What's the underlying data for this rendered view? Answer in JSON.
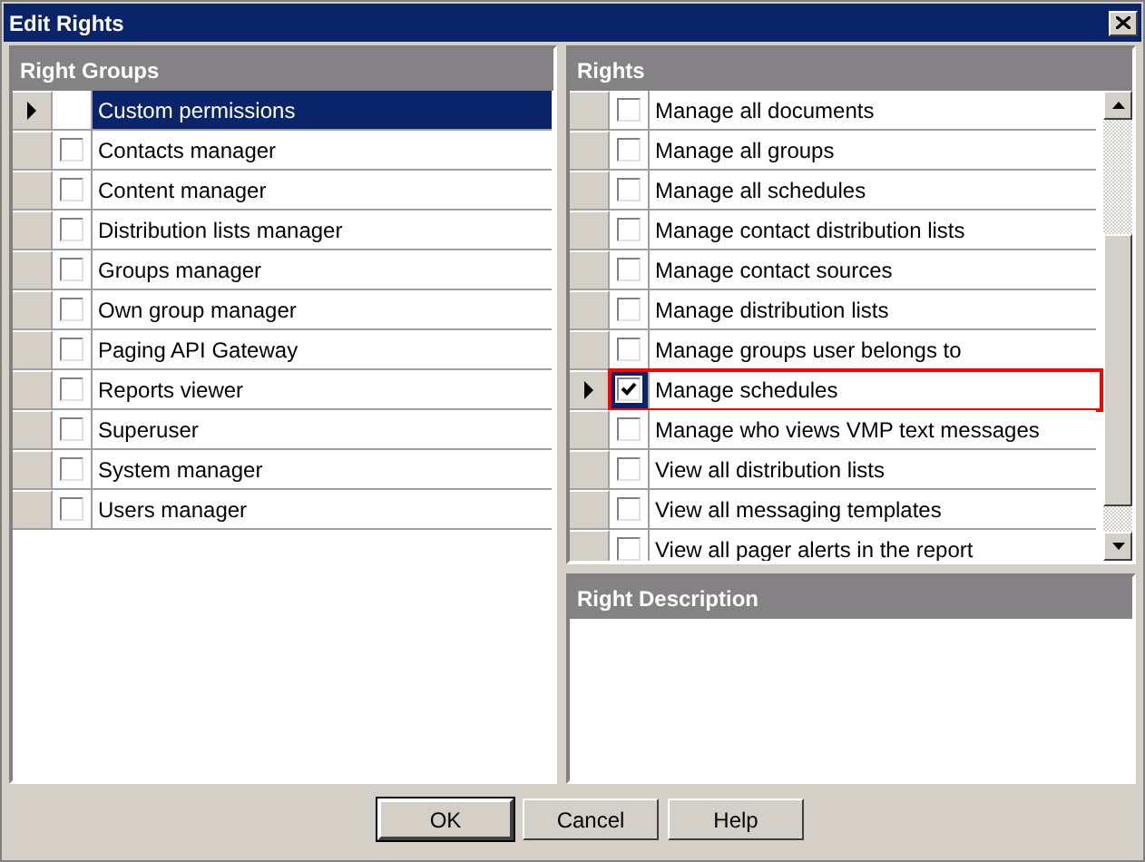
{
  "window": {
    "title": "Edit Rights"
  },
  "right_groups": {
    "title": "Right Groups",
    "items": [
      {
        "label": "Custom permissions",
        "kind": "plain",
        "selected": true
      },
      {
        "label": "Contacts manager",
        "kind": "checkbox",
        "checked": false,
        "selected": false
      },
      {
        "label": "Content manager",
        "kind": "checkbox",
        "checked": false,
        "selected": false
      },
      {
        "label": "Distribution lists manager",
        "kind": "checkbox",
        "checked": false,
        "selected": false
      },
      {
        "label": "Groups manager",
        "kind": "checkbox",
        "checked": false,
        "selected": false
      },
      {
        "label": "Own group manager",
        "kind": "checkbox",
        "checked": false,
        "selected": false
      },
      {
        "label": "Paging API Gateway",
        "kind": "checkbox",
        "checked": false,
        "selected": false
      },
      {
        "label": "Reports viewer",
        "kind": "checkbox",
        "checked": false,
        "selected": false
      },
      {
        "label": "Superuser",
        "kind": "checkbox",
        "checked": false,
        "selected": false
      },
      {
        "label": "System manager",
        "kind": "checkbox",
        "checked": false,
        "selected": false
      },
      {
        "label": "Users manager",
        "kind": "checkbox",
        "checked": false,
        "selected": false
      }
    ]
  },
  "rights": {
    "title": "Rights",
    "items": [
      {
        "label": "Manage all documents",
        "checked": false,
        "selected": false,
        "highlighted": false
      },
      {
        "label": "Manage all groups",
        "checked": false,
        "selected": false,
        "highlighted": false
      },
      {
        "label": "Manage all schedules",
        "checked": false,
        "selected": false,
        "highlighted": false
      },
      {
        "label": "Manage contact distribution lists",
        "checked": false,
        "selected": false,
        "highlighted": false
      },
      {
        "label": "Manage contact sources",
        "checked": false,
        "selected": false,
        "highlighted": false
      },
      {
        "label": "Manage distribution lists",
        "checked": false,
        "selected": false,
        "highlighted": false
      },
      {
        "label": "Manage groups user belongs to",
        "checked": false,
        "selected": false,
        "highlighted": false
      },
      {
        "label": "Manage schedules",
        "checked": true,
        "selected": true,
        "highlighted": true
      },
      {
        "label": "Manage who views VMP text messages",
        "checked": false,
        "selected": false,
        "highlighted": false
      },
      {
        "label": "View all distribution lists",
        "checked": false,
        "selected": false,
        "highlighted": false
      },
      {
        "label": "View all messaging templates",
        "checked": false,
        "selected": false,
        "highlighted": false
      },
      {
        "label": "View all pager alerts in the report",
        "checked": false,
        "selected": false,
        "highlighted": false
      }
    ]
  },
  "right_description": {
    "title": "Right Description"
  },
  "buttons": [
    {
      "label": "OK",
      "default": true
    },
    {
      "label": "Cancel",
      "default": false
    },
    {
      "label": "Help",
      "default": false
    }
  ]
}
